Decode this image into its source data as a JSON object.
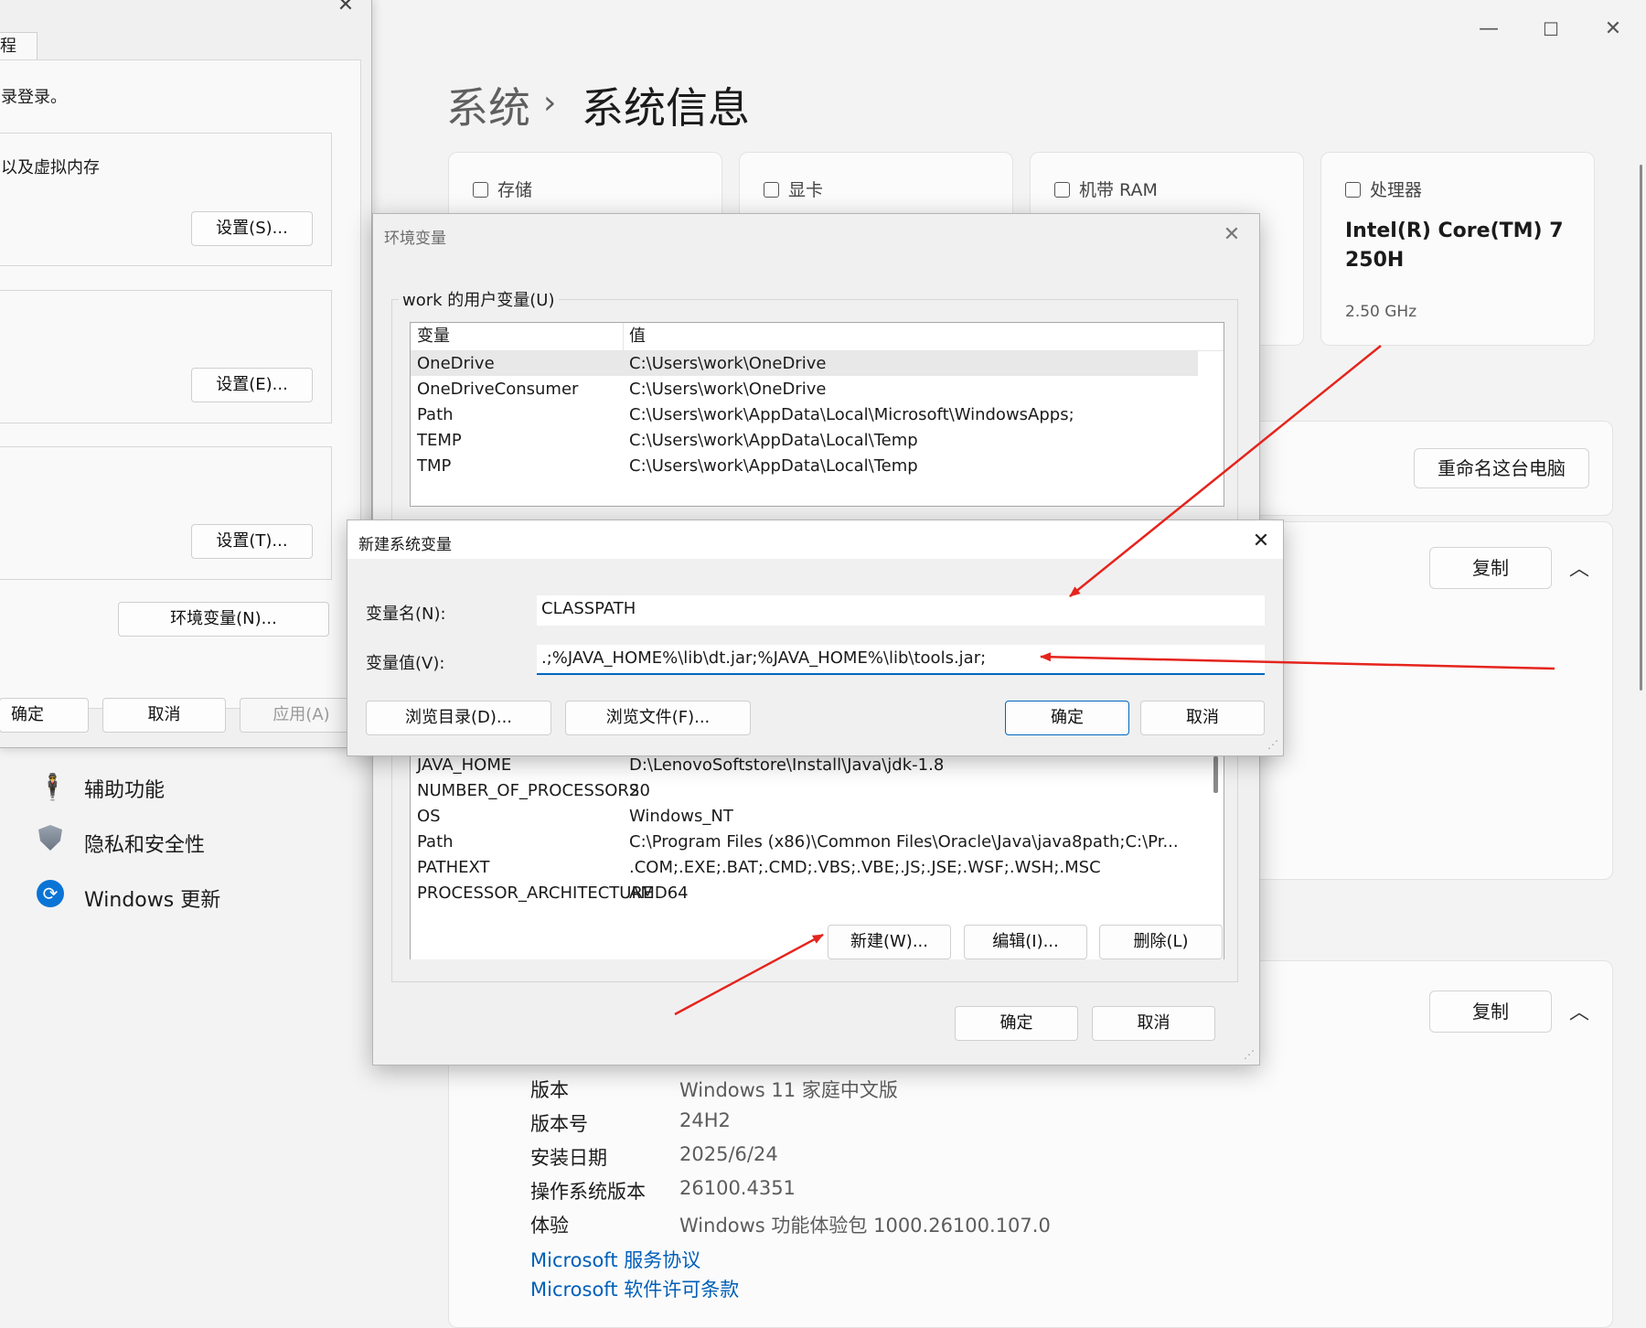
{
  "settings": {
    "window_controls": {
      "minimize": "—",
      "maximize": "☐",
      "close": "✕"
    },
    "breadcrumb": {
      "parent": "系统",
      "separator": "›",
      "current": "系统信息"
    },
    "cards": [
      {
        "icon": "storage-icon",
        "label": "存储"
      },
      {
        "icon": "gpu-icon",
        "label": "显卡"
      },
      {
        "icon": "ram-icon",
        "label": "机带 RAM"
      },
      {
        "icon": "cpu-icon",
        "label": "处理器",
        "value": "Intel(R) Core(TM) 7 250H",
        "sub": "2.50 GHz"
      }
    ],
    "rename_button": "重命名这台电脑",
    "copy_button": "复制",
    "nav": [
      {
        "icon": "accessibility-icon",
        "label": "辅助功能"
      },
      {
        "icon": "shield-icon",
        "label": "隐私和安全性"
      },
      {
        "icon": "windows-update-icon",
        "label": "Windows 更新"
      }
    ],
    "specs": [
      {
        "k": "版本",
        "v": "Windows 11 家庭中文版"
      },
      {
        "k": "版本号",
        "v": "24H2"
      },
      {
        "k": "安装日期",
        "v": "2025/6/24"
      },
      {
        "k": "操作系统版本",
        "v": "26100.4351"
      },
      {
        "k": "体验",
        "v": "Windows 功能体验包 1000.26100.107.0"
      }
    ],
    "links": [
      "Microsoft 服务协议",
      "Microsoft 软件许可条款"
    ]
  },
  "sysprops": {
    "tab": "程",
    "text1": "录登录。",
    "text2": "以及虚拟内存",
    "settings_s": "设置(S)...",
    "settings_e": "设置(E)...",
    "settings_t": "设置(T)...",
    "env_button": "环境变量(N)...",
    "ok": "确定",
    "cancel": "取消",
    "apply": "应用(A)"
  },
  "envdlg": {
    "title": "环境变量",
    "user_group": "work 的用户变量(U)",
    "col_var": "变量",
    "col_val": "值",
    "user_vars": [
      {
        "name": "OneDrive",
        "value": "C:\\Users\\work\\OneDrive"
      },
      {
        "name": "OneDriveConsumer",
        "value": "C:\\Users\\work\\OneDrive"
      },
      {
        "name": "Path",
        "value": "C:\\Users\\work\\AppData\\Local\\Microsoft\\WindowsApps;"
      },
      {
        "name": "TEMP",
        "value": "C:\\Users\\work\\AppData\\Local\\Temp"
      },
      {
        "name": "TMP",
        "value": "C:\\Users\\work\\AppData\\Local\\Temp"
      }
    ],
    "sys_vars": [
      {
        "name": "JAVA_HOME",
        "value": "D:\\LenovoSoftstore\\Install\\Java\\jdk-1.8"
      },
      {
        "name": "NUMBER_OF_PROCESSORS",
        "value": "20"
      },
      {
        "name": "OS",
        "value": "Windows_NT"
      },
      {
        "name": "Path",
        "value": "C:\\Program Files (x86)\\Common Files\\Oracle\\Java\\java8path;C:\\Pr..."
      },
      {
        "name": "PATHEXT",
        "value": ".COM;.EXE;.BAT;.CMD;.VBS;.VBE;.JS;.JSE;.WSF;.WSH;.MSC"
      },
      {
        "name": "PROCESSOR_ARCHITECTURE",
        "value": "AMD64"
      }
    ],
    "new_button": "新建(W)...",
    "edit_button": "编辑(I)...",
    "delete_button": "删除(L)",
    "ok": "确定",
    "cancel": "取消"
  },
  "newvar": {
    "title": "新建系统变量",
    "name_label": "变量名(N):",
    "value_label": "变量值(V):",
    "name_value": "CLASSPATH",
    "value_value": ".;%JAVA_HOME%\\lib\\dt.jar;%JAVA_HOME%\\lib\\tools.jar;",
    "browse_dir": "浏览目录(D)...",
    "browse_file": "浏览文件(F)...",
    "ok": "确定",
    "cancel": "取消"
  },
  "colors": {
    "annotation_arrow": "#e5241d",
    "accent": "#0067c0",
    "link": "#005fb8"
  }
}
